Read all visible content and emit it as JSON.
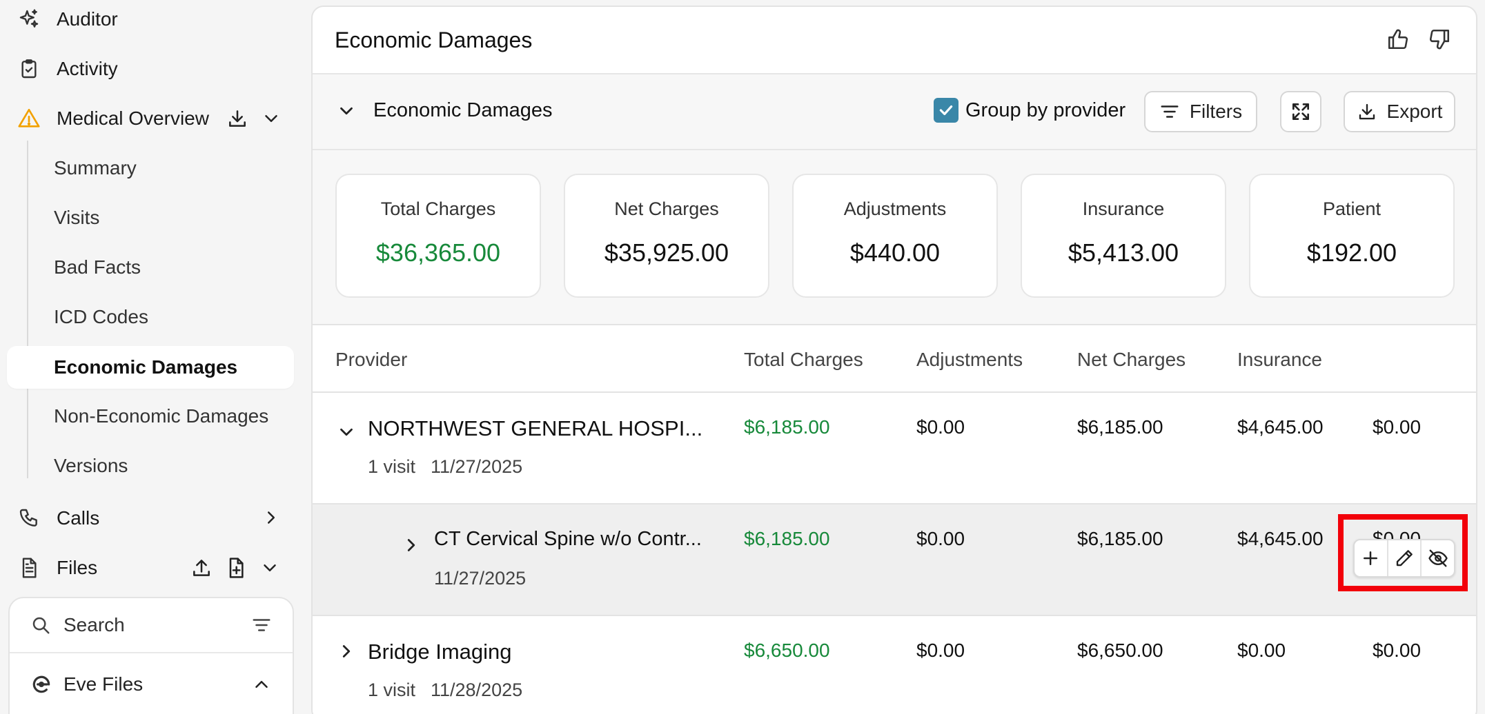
{
  "sidebar": {
    "nav": {
      "auditor": "Auditor",
      "activity": "Activity",
      "medical_overview": "Medical Overview",
      "calls": "Calls",
      "files": "Files"
    },
    "medical_sub_items": [
      "Summary",
      "Visits",
      "Bad Facts",
      "ICD Codes",
      "Economic Damages",
      "Non-Economic Damages",
      "Versions"
    ],
    "active_item": "Economic Damages",
    "search": {
      "label": "Search"
    },
    "eve_files": {
      "label": "Eve Files"
    }
  },
  "main": {
    "title": "Economic Damages",
    "section": {
      "title": "Economic Damages",
      "group_by_provider": {
        "label": "Group by provider",
        "checked": true
      },
      "filters_label": "Filters",
      "export_label": "Export"
    },
    "stats": [
      {
        "label": "Total Charges",
        "value": "$36,365.00",
        "highlight": true
      },
      {
        "label": "Net Charges",
        "value": "$35,925.00"
      },
      {
        "label": "Adjustments",
        "value": "$440.00"
      },
      {
        "label": "Insurance",
        "value": "$5,413.00"
      },
      {
        "label": "Patient",
        "value": "$192.00"
      }
    ],
    "table": {
      "headers": [
        "Provider",
        "Total Charges",
        "Adjustments",
        "Net Charges",
        "Insurance"
      ],
      "rows": [
        {
          "name": "NORTHWEST GENERAL HOSPI...",
          "visits": "1 visit",
          "date": "11/27/2025",
          "total": "$6,185.00",
          "adjustments": "$0.00",
          "net": "$6,185.00",
          "insurance": "$4,645.00",
          "patient": "$0.00"
        },
        {
          "name": "CT Cervical Spine w/o Contr...",
          "date": "11/27/2025",
          "total": "$6,185.00",
          "adjustments": "$0.00",
          "net": "$6,185.00",
          "insurance": "$4,645.00",
          "patient": "$0.00"
        },
        {
          "name": "Bridge Imaging",
          "visits": "1 visit",
          "date": "11/28/2025",
          "total": "$6,650.00",
          "adjustments": "$0.00",
          "net": "$6,650.00",
          "insurance": "$0.00",
          "patient": "$0.00"
        }
      ]
    }
  },
  "colors": {
    "accent_teal": "#3a87a8",
    "money_green": "#17893a",
    "warning_amber": "#f2a100",
    "highlight_red": "#f2000a"
  }
}
